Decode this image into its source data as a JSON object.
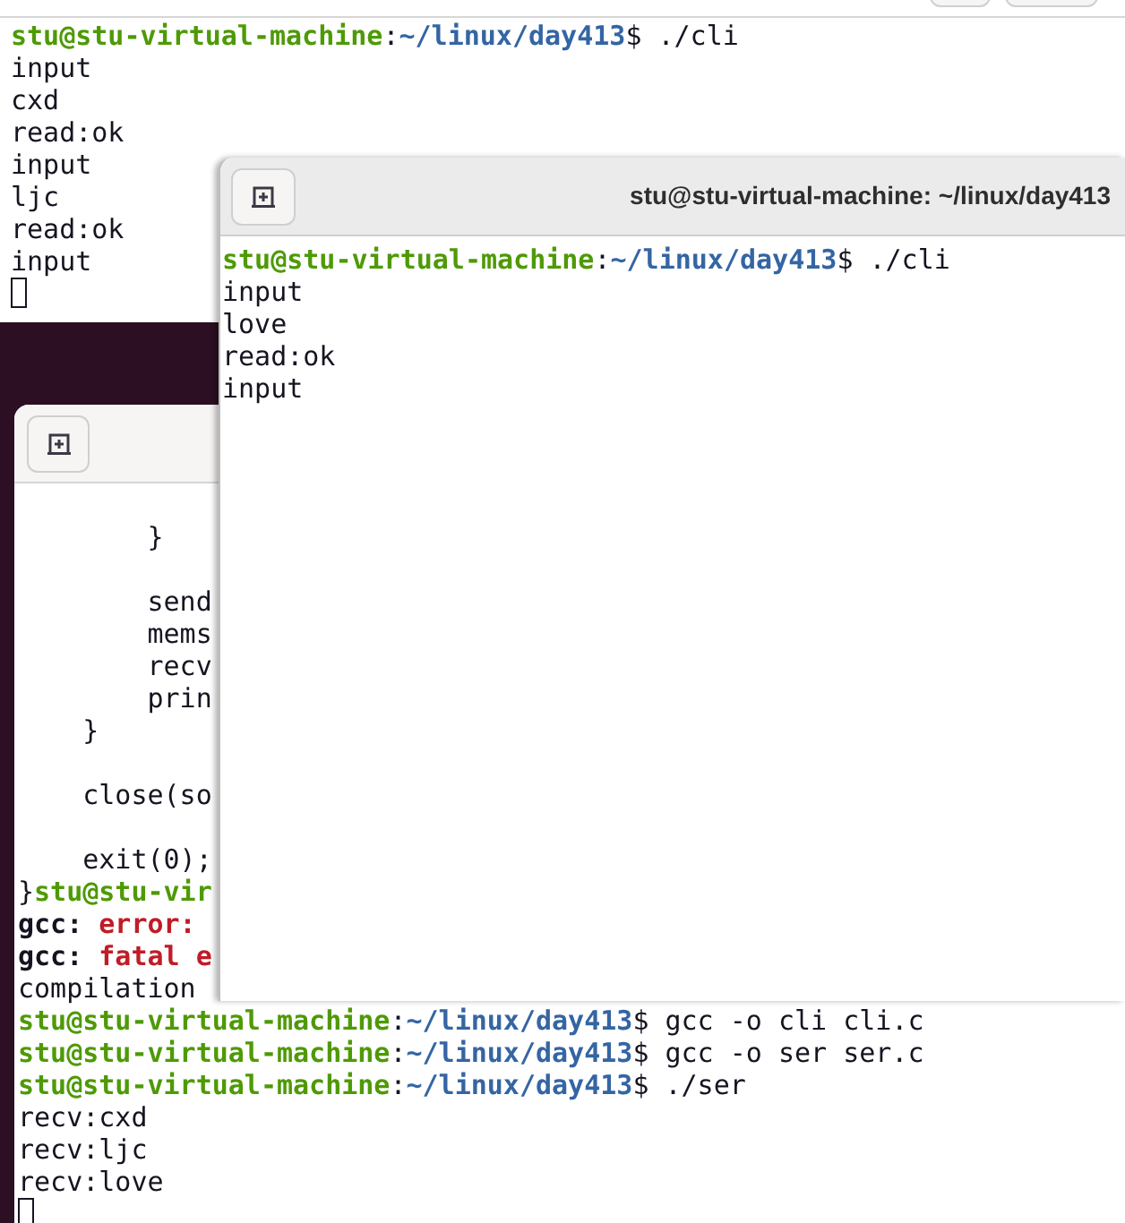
{
  "windows": [
    {
      "kind": "top_terminal",
      "lines": [
        {
          "kind": "prompt",
          "user": "stu@stu-virtual-machine",
          "sep": ":",
          "path": "~/linux/day413",
          "sign": "$",
          "command": " ./cli"
        },
        {
          "kind": "plain",
          "text": "input"
        },
        {
          "kind": "plain",
          "text": "cxd"
        },
        {
          "kind": "plain",
          "text": "read:ok"
        },
        {
          "kind": "plain",
          "text": "input"
        },
        {
          "kind": "plain",
          "text": "ljc"
        },
        {
          "kind": "plain",
          "text": "read:ok"
        },
        {
          "kind": "plain",
          "text": "input"
        },
        {
          "kind": "cursor"
        }
      ]
    },
    {
      "kind": "editor_terminal",
      "lines": [
        {
          "kind": "blank"
        },
        {
          "kind": "plain",
          "text": "        }"
        },
        {
          "kind": "blank"
        },
        {
          "kind": "plain",
          "text": "        send"
        },
        {
          "kind": "plain",
          "text": "        mems"
        },
        {
          "kind": "plain",
          "text": "        recv"
        },
        {
          "kind": "plain",
          "text": "        prin"
        },
        {
          "kind": "plain",
          "text": "    }"
        },
        {
          "kind": "blank"
        },
        {
          "kind": "plain",
          "text": "    close(so"
        },
        {
          "kind": "blank"
        },
        {
          "kind": "plain",
          "text": "    exit(0);"
        },
        {
          "kind": "prompt",
          "prefix": "}",
          "user": "stu@stu-vir"
        },
        {
          "kind": "error",
          "prefix": "gcc: ",
          "label": "error:"
        },
        {
          "kind": "error",
          "prefix": "gcc: ",
          "label": "fatal e"
        },
        {
          "kind": "plain",
          "text": "compilation"
        },
        {
          "kind": "prompt",
          "user": "stu@stu-virtual-machine",
          "sep": ":",
          "path": "~/linux/day413",
          "sign": "$",
          "command": " gcc -o cli cli.c"
        },
        {
          "kind": "prompt",
          "user": "stu@stu-virtual-machine",
          "sep": ":",
          "path": "~/linux/day413",
          "sign": "$",
          "command": " gcc -o ser ser.c"
        },
        {
          "kind": "prompt",
          "user": "stu@stu-virtual-machine",
          "sep": ":",
          "path": "~/linux/day413",
          "sign": "$",
          "command": " ./ser"
        },
        {
          "kind": "plain",
          "text": "recv:cxd"
        },
        {
          "kind": "plain",
          "text": "recv:ljc"
        },
        {
          "kind": "plain",
          "text": "recv:love"
        },
        {
          "kind": "cursor"
        }
      ]
    },
    {
      "kind": "front_terminal",
      "title": "stu@stu-virtual-machine: ~/linux/day413",
      "lines": [
        {
          "kind": "prompt",
          "user": "stu@stu-virtual-machine",
          "sep": ":",
          "path": "~/linux/day413",
          "sign": "$",
          "command": " ./cli"
        },
        {
          "kind": "plain",
          "text": "input"
        },
        {
          "kind": "plain",
          "text": "love"
        },
        {
          "kind": "plain",
          "text": "read:ok"
        },
        {
          "kind": "plain",
          "text": "input"
        }
      ]
    }
  ]
}
